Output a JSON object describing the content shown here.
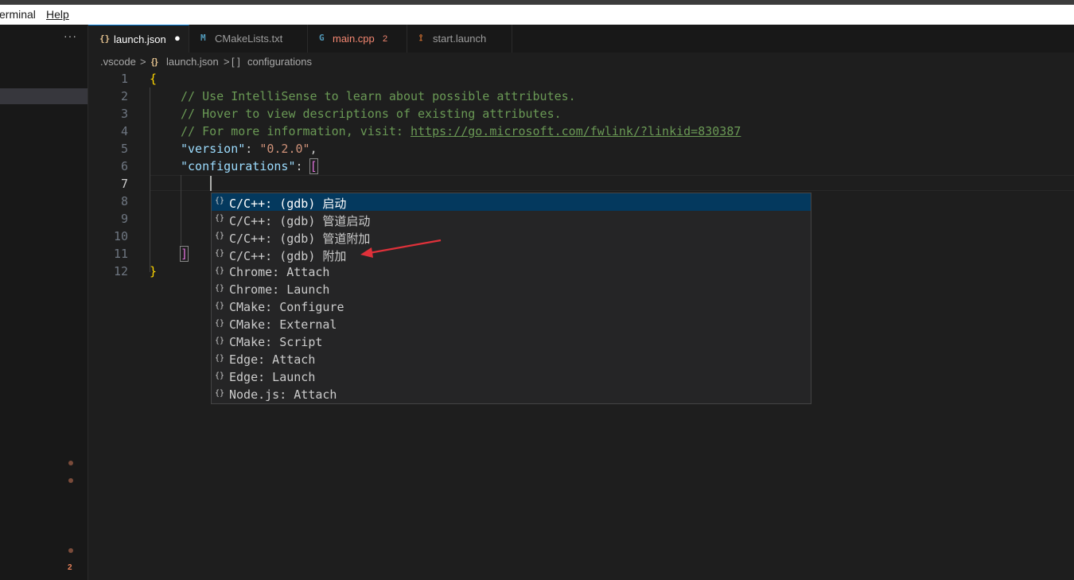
{
  "menubar": {
    "items": [
      "erminal",
      "Help"
    ]
  },
  "sidebar": {
    "more_label": "···",
    "badge_count": "2"
  },
  "tabs": [
    {
      "icon": "{}",
      "label": "launch.json",
      "modified": "●",
      "icon_color": "#e2c08d"
    },
    {
      "icon": "M",
      "label": "CMakeLists.txt",
      "modified": "",
      "icon_color": "#519aba"
    },
    {
      "icon": "G",
      "label": "main.cpp",
      "modified": "2",
      "icon_color": "#519aba"
    },
    {
      "icon": "⟟",
      "label": "start.launch",
      "modified": "",
      "icon_color": "#e37933"
    }
  ],
  "breadcrumb": {
    "folder": ".vscode",
    "sep": ">",
    "file_icon": "{}",
    "file": "launch.json",
    "symbol_icon": "[ ]",
    "symbol": "configurations"
  },
  "editor": {
    "line_numbers": [
      "1",
      "2",
      "3",
      "4",
      "5",
      "6",
      "7",
      "8",
      "9",
      "10",
      "11",
      "12"
    ],
    "current_line": "7",
    "lines": {
      "l1_brace": "{",
      "l2_comment": "// Use IntelliSense to learn about possible attributes.",
      "l3_comment": "// Hover to view descriptions of existing attributes.",
      "l4_comment": "// For more information, visit: ",
      "l4_link": "https://go.microsoft.com/fwlink/?linkid=830387",
      "l5_key": "\"version\"",
      "l5_colon": ": ",
      "l5_value": "\"0.2.0\"",
      "l5_comma": ",",
      "l6_key": "\"configurations\"",
      "l6_colon": ": ",
      "l6_bracket": "[",
      "l11_bracket": "]",
      "l12_brace": "}"
    }
  },
  "suggestions": {
    "icon": "{}",
    "items": [
      "C/C++: (gdb) 启动",
      "C/C++: (gdb) 管道启动",
      "C/C++: (gdb) 管道附加",
      "C/C++: (gdb) 附加",
      "Chrome: Attach",
      "Chrome: Launch",
      "CMake: Configure",
      "CMake: External",
      "CMake: Script",
      "Edge: Attach",
      "Edge: Launch",
      "Node.js: Attach"
    ],
    "selected_index": 0
  },
  "colors": {
    "comment": "#6a9955",
    "key": "#9cdcfe",
    "string": "#ce9178",
    "brace": "#ffd700",
    "bracket": "#da70d6",
    "annotation_arrow": "#e0313a"
  }
}
